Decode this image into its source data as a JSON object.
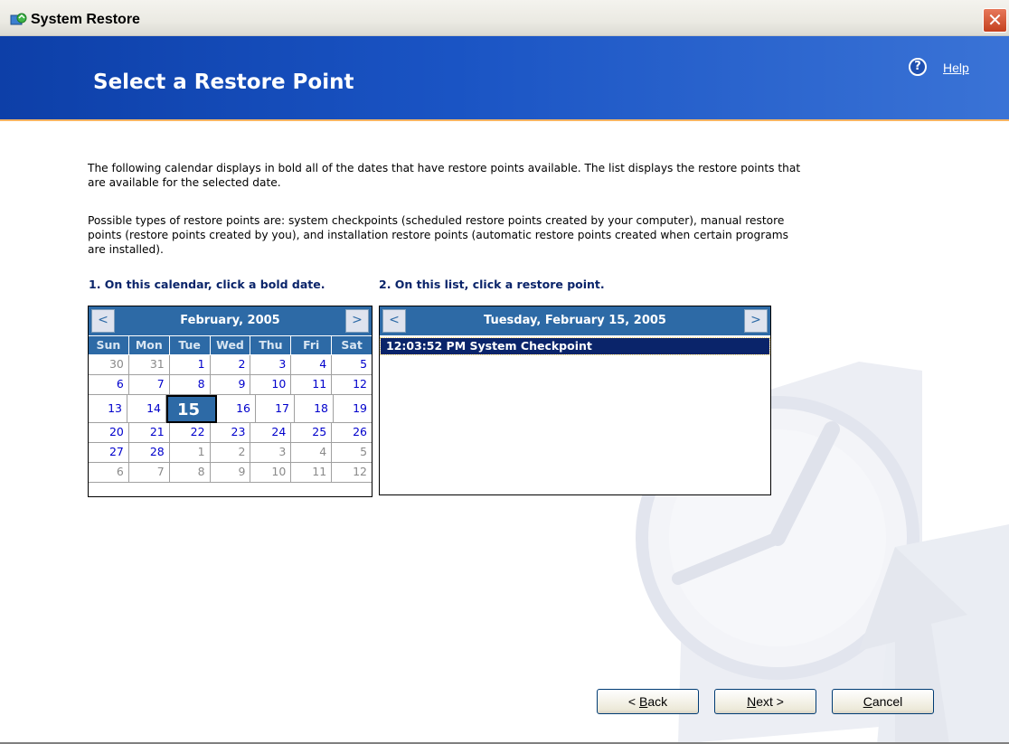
{
  "window": {
    "title": "System Restore",
    "close_glyph": "✕"
  },
  "header": {
    "title": "Select a Restore Point",
    "help_icon": "?",
    "help_label": "Help"
  },
  "intro": {
    "para1": "The following calendar displays in bold all of the dates that have restore points available. The list displays the restore points that are available for the selected date.",
    "para2": "Possible types of restore points are: system checkpoints (scheduled restore points created by your computer), manual restore points (restore points created by you), and installation restore points (automatic restore points created when certain programs are installed)."
  },
  "steps": {
    "step1": "1. On this calendar, click a bold date.",
    "step2": "2. On this list, click a restore point."
  },
  "calendar": {
    "prev_glyph": "<",
    "next_glyph": ">",
    "month_label": "February, 2005",
    "days_of_week": [
      "Sun",
      "Mon",
      "Tue",
      "Wed",
      "Thu",
      "Fri",
      "Sat"
    ],
    "weeks": [
      [
        {
          "d": "30",
          "other": true
        },
        {
          "d": "31",
          "other": true
        },
        {
          "d": "1"
        },
        {
          "d": "2"
        },
        {
          "d": "3"
        },
        {
          "d": "4"
        },
        {
          "d": "5"
        }
      ],
      [
        {
          "d": "6"
        },
        {
          "d": "7"
        },
        {
          "d": "8"
        },
        {
          "d": "9"
        },
        {
          "d": "10"
        },
        {
          "d": "11"
        },
        {
          "d": "12"
        }
      ],
      [
        {
          "d": "13"
        },
        {
          "d": "14"
        },
        {
          "d": "15",
          "selected": true
        },
        {
          "d": "16"
        },
        {
          "d": "17"
        },
        {
          "d": "18"
        },
        {
          "d": "19"
        }
      ],
      [
        {
          "d": "20"
        },
        {
          "d": "21"
        },
        {
          "d": "22"
        },
        {
          "d": "23"
        },
        {
          "d": "24"
        },
        {
          "d": "25"
        },
        {
          "d": "26"
        }
      ],
      [
        {
          "d": "27"
        },
        {
          "d": "28"
        },
        {
          "d": "1",
          "other": true
        },
        {
          "d": "2",
          "other": true
        },
        {
          "d": "3",
          "other": true
        },
        {
          "d": "4",
          "other": true
        },
        {
          "d": "5",
          "other": true
        }
      ],
      [
        {
          "d": "6",
          "other": true
        },
        {
          "d": "7",
          "other": true
        },
        {
          "d": "8",
          "other": true
        },
        {
          "d": "9",
          "other": true
        },
        {
          "d": "10",
          "other": true
        },
        {
          "d": "11",
          "other": true
        },
        {
          "d": "12",
          "other": true
        }
      ]
    ]
  },
  "restore_list": {
    "prev_glyph": "<",
    "next_glyph": ">",
    "date_label": "Tuesday, February 15, 2005",
    "items": [
      {
        "label": "12:03:52 PM  System Checkpoint",
        "selected": true
      }
    ]
  },
  "buttons": {
    "back_prefix": "< ",
    "back_hotkey": "B",
    "back_rest": "ack",
    "next_hotkey": "N",
    "next_rest": "ext >",
    "cancel_hotkey": "C",
    "cancel_rest": "ancel"
  },
  "colors": {
    "header_blue": "#1a54c4",
    "calendar_blue": "#2d6aa6",
    "selection_navy": "#0a246a",
    "accent_orange": "#f6b463"
  }
}
